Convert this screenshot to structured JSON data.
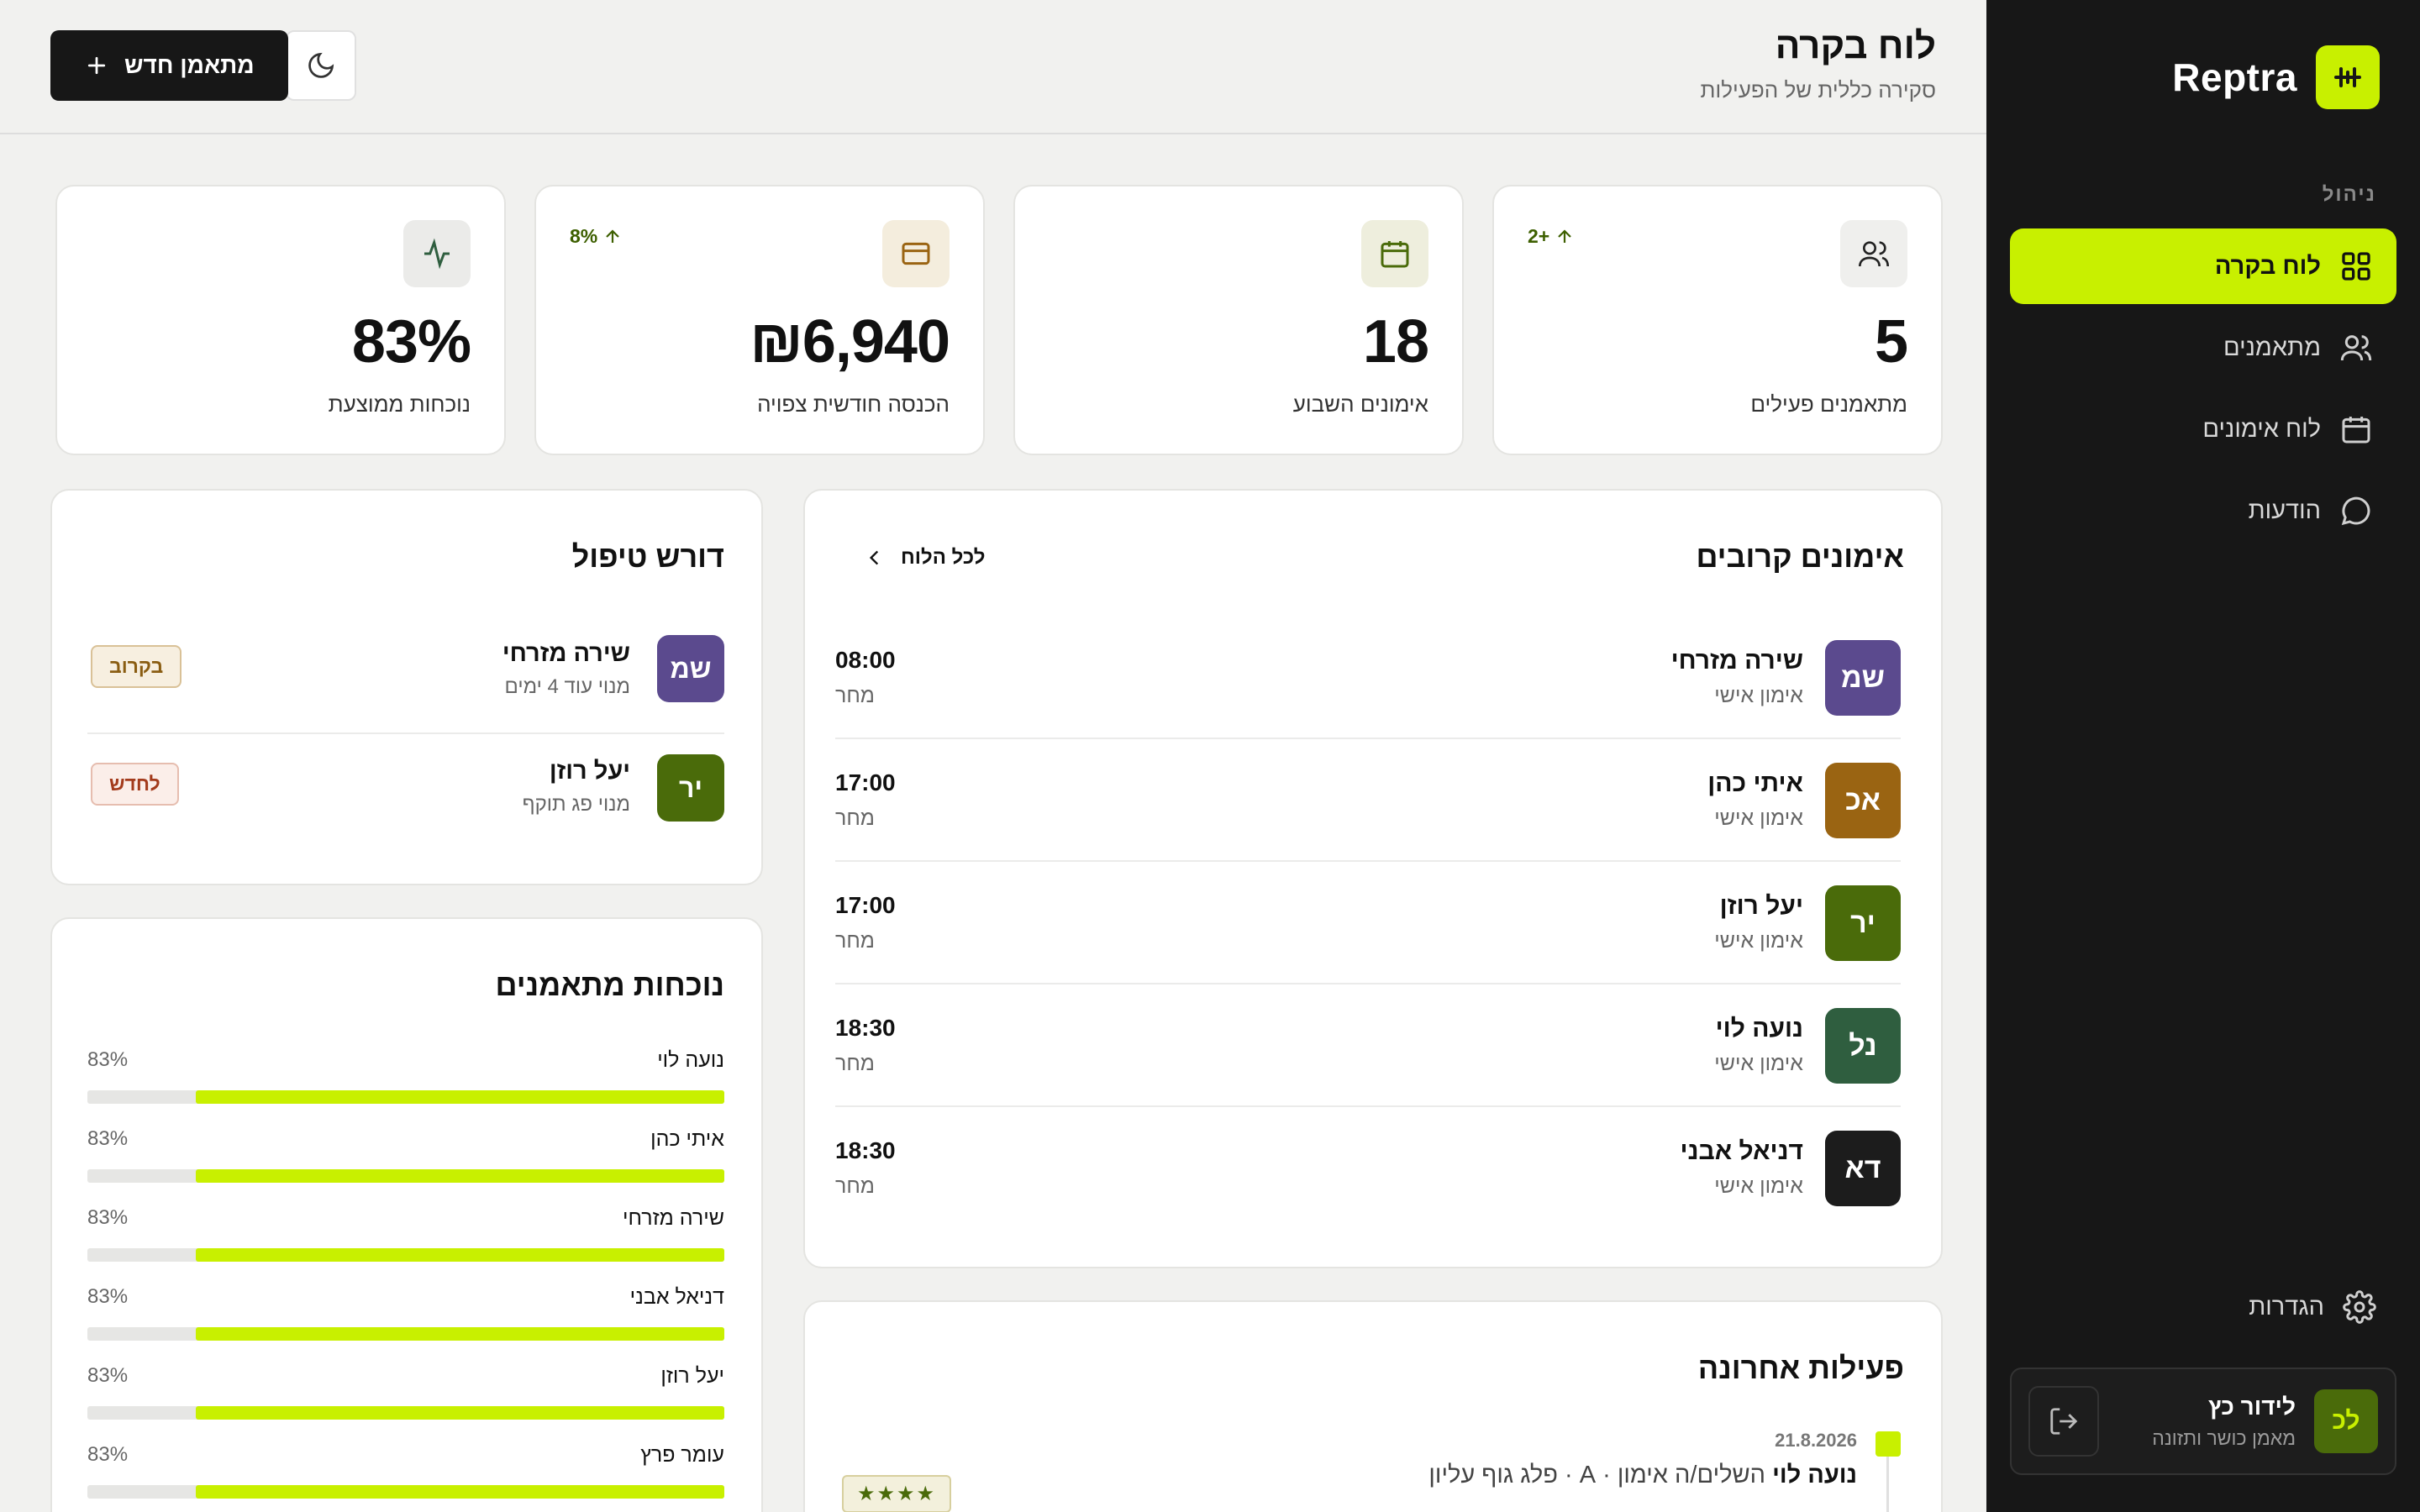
{
  "sidebar": {
    "brand": "Reptra",
    "section_label": "ניהול",
    "items": [
      {
        "label": "לוח בקרה",
        "icon": "grid-icon",
        "active": true
      },
      {
        "label": "מתאמנים",
        "icon": "users-icon",
        "active": false
      },
      {
        "label": "לוח אימונים",
        "icon": "calendar-icon",
        "active": false
      },
      {
        "label": "הודעות",
        "icon": "chat-icon",
        "active": false
      }
    ],
    "settings_label": "הגדרות",
    "user": {
      "initials": "לכ",
      "name": "לידור כץ",
      "role": "מאמן כושר ותזונה"
    }
  },
  "header": {
    "title": "לוח בקרה",
    "subtitle": "סקירה כללית של הפעילות",
    "new_button": "מתאמן חדש"
  },
  "stats": [
    {
      "value": "5",
      "label": "מתאמנים פעילים",
      "delta": "2+",
      "icon": "users-icon"
    },
    {
      "value": "18",
      "label": "אימונים השבוע",
      "delta": "",
      "icon": "calendar-icon"
    },
    {
      "value": "₪6,940",
      "label": "הכנסה חודשית צפויה",
      "delta": "8%",
      "icon": "credit-card-icon"
    },
    {
      "value": "83%",
      "label": "נוכחות ממוצעת",
      "delta": "",
      "icon": "activity-icon"
    }
  ],
  "sessions": {
    "title": "אימונים קרובים",
    "see_all": "לכל הלוח",
    "rows": [
      {
        "initials": "שמ",
        "name": "שירה מזרחי",
        "type": "אימון אישי",
        "time": "08:00",
        "day": "מחר",
        "color": "#5b4a8e"
      },
      {
        "initials": "אכ",
        "name": "איתי כהן",
        "type": "אימון אישי",
        "time": "17:00",
        "day": "מחר",
        "color": "#9a6412"
      },
      {
        "initials": "יר",
        "name": "יעל רוזן",
        "type": "אימון אישי",
        "time": "17:00",
        "day": "מחר",
        "color": "#4a6b0a"
      },
      {
        "initials": "נל",
        "name": "נועה לוי",
        "type": "אימון אישי",
        "time": "18:30",
        "day": "מחר",
        "color": "#2f5e3f"
      },
      {
        "initials": "דא",
        "name": "דניאל אבני",
        "type": "אימון אישי",
        "time": "18:30",
        "day": "מחר",
        "color": "#1c1c1c"
      }
    ]
  },
  "attention": {
    "title": "דורש טיפול",
    "rows": [
      {
        "initials": "שמ",
        "name": "שירה מזרחי",
        "note": "מנוי עוד 4 ימים",
        "badge": "בקרוב",
        "color": "#5b4a8e",
        "badge_bg": "#f7efe0",
        "badge_fg": "#8a5d12",
        "badge_border": "#d9c197"
      },
      {
        "initials": "יר",
        "name": "יעל רוזן",
        "note": "מנוי פג תוקף",
        "badge": "לחדש",
        "color": "#4a6b0a",
        "badge_bg": "#fbeee9",
        "badge_fg": "#a33b1c",
        "badge_border": "#e6bdaf"
      }
    ]
  },
  "attendance": {
    "title": "נוכחות מתאמנים",
    "rows": [
      {
        "name": "נועה לוי",
        "pct": "83%",
        "value": 83
      },
      {
        "name": "איתי כהן",
        "pct": "83%",
        "value": 83
      },
      {
        "name": "שירה מזרחי",
        "pct": "83%",
        "value": 83
      },
      {
        "name": "דניאל אבני",
        "pct": "83%",
        "value": 83
      },
      {
        "name": "יעל רוזן",
        "pct": "83%",
        "value": 83
      },
      {
        "name": "עומר פרץ",
        "pct": "83%",
        "value": 83
      }
    ]
  },
  "activity": {
    "title": "פעילות אחרונה",
    "item": {
      "date": "21.8.2026",
      "name": "נועה לוי",
      "text": "השלים/ה אימון · A · פלג גוף עליון",
      "rating": "★★★★"
    }
  }
}
